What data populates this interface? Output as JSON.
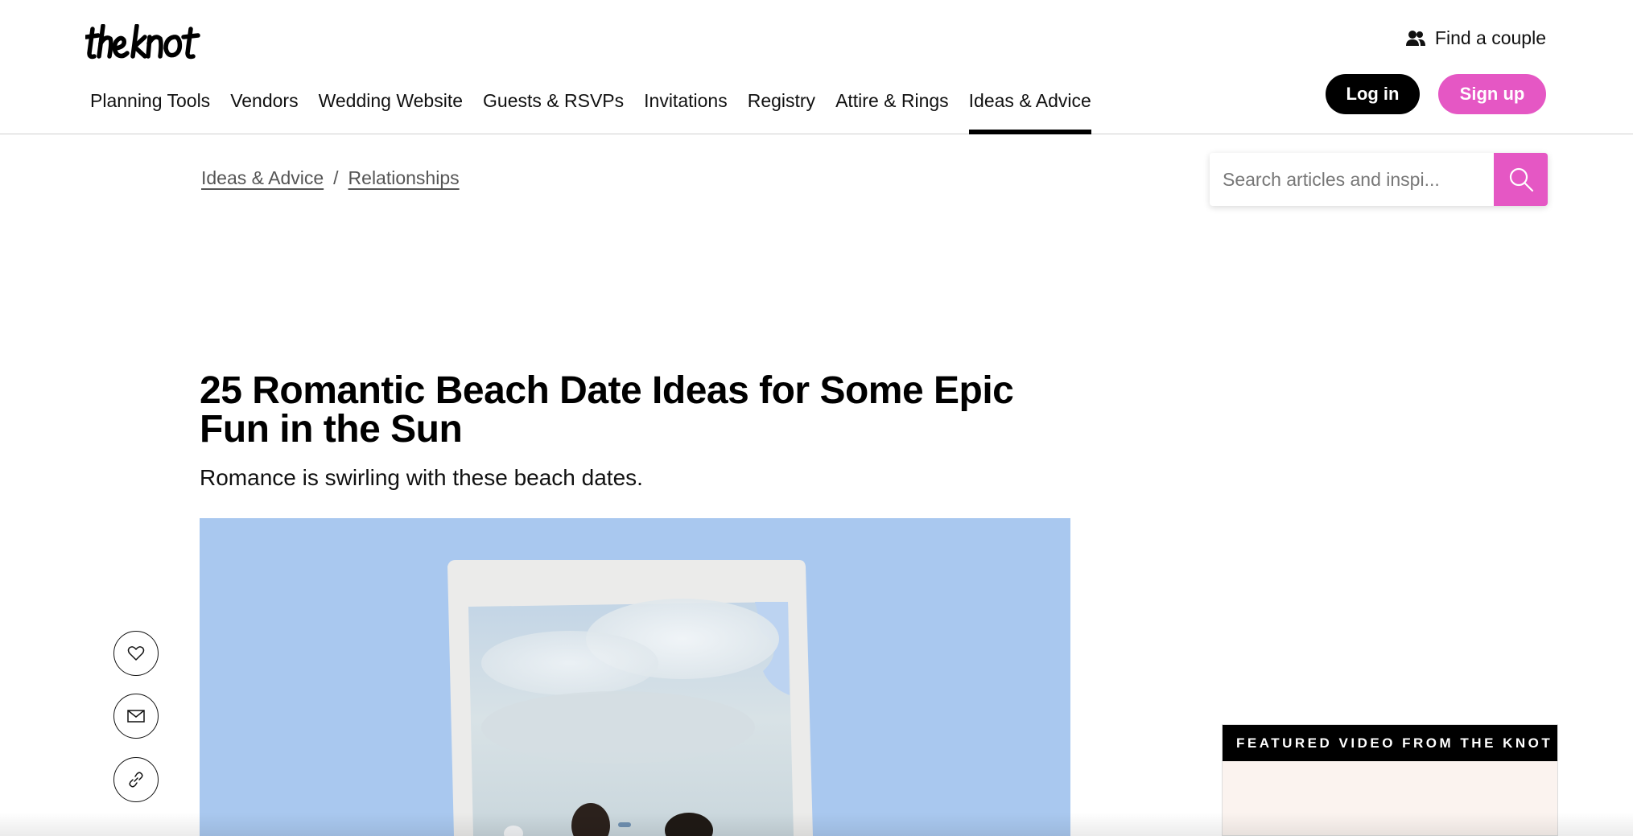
{
  "header": {
    "logo_text": "the knot",
    "find_couple_label": "Find a couple",
    "nav": [
      {
        "label": "Planning Tools",
        "active": false
      },
      {
        "label": "Vendors",
        "active": false
      },
      {
        "label": "Wedding Website",
        "active": false
      },
      {
        "label": "Guests & RSVPs",
        "active": false
      },
      {
        "label": "Invitations",
        "active": false
      },
      {
        "label": "Registry",
        "active": false
      },
      {
        "label": "Attire & Rings",
        "active": false
      },
      {
        "label": "Ideas & Advice",
        "active": true
      }
    ],
    "login_label": "Log in",
    "signup_label": "Sign up"
  },
  "breadcrumb": {
    "items": [
      "Ideas & Advice",
      "Relationships"
    ],
    "separator": "/"
  },
  "search": {
    "placeholder": "Search articles and inspi..."
  },
  "article": {
    "title": "25 Romantic Beach Date Ideas for Some Epic Fun in the Sun",
    "dek": "Romance is swirling with these beach dates."
  },
  "social": {
    "icons": [
      "heart-icon",
      "mail-icon",
      "link-icon"
    ]
  },
  "featured_video": {
    "label": "FEATURED VIDEO FROM THE KNOT"
  },
  "colors": {
    "brand_pink": "#e557c4",
    "black": "#000000",
    "hero_sky": "#a9c8ef"
  }
}
